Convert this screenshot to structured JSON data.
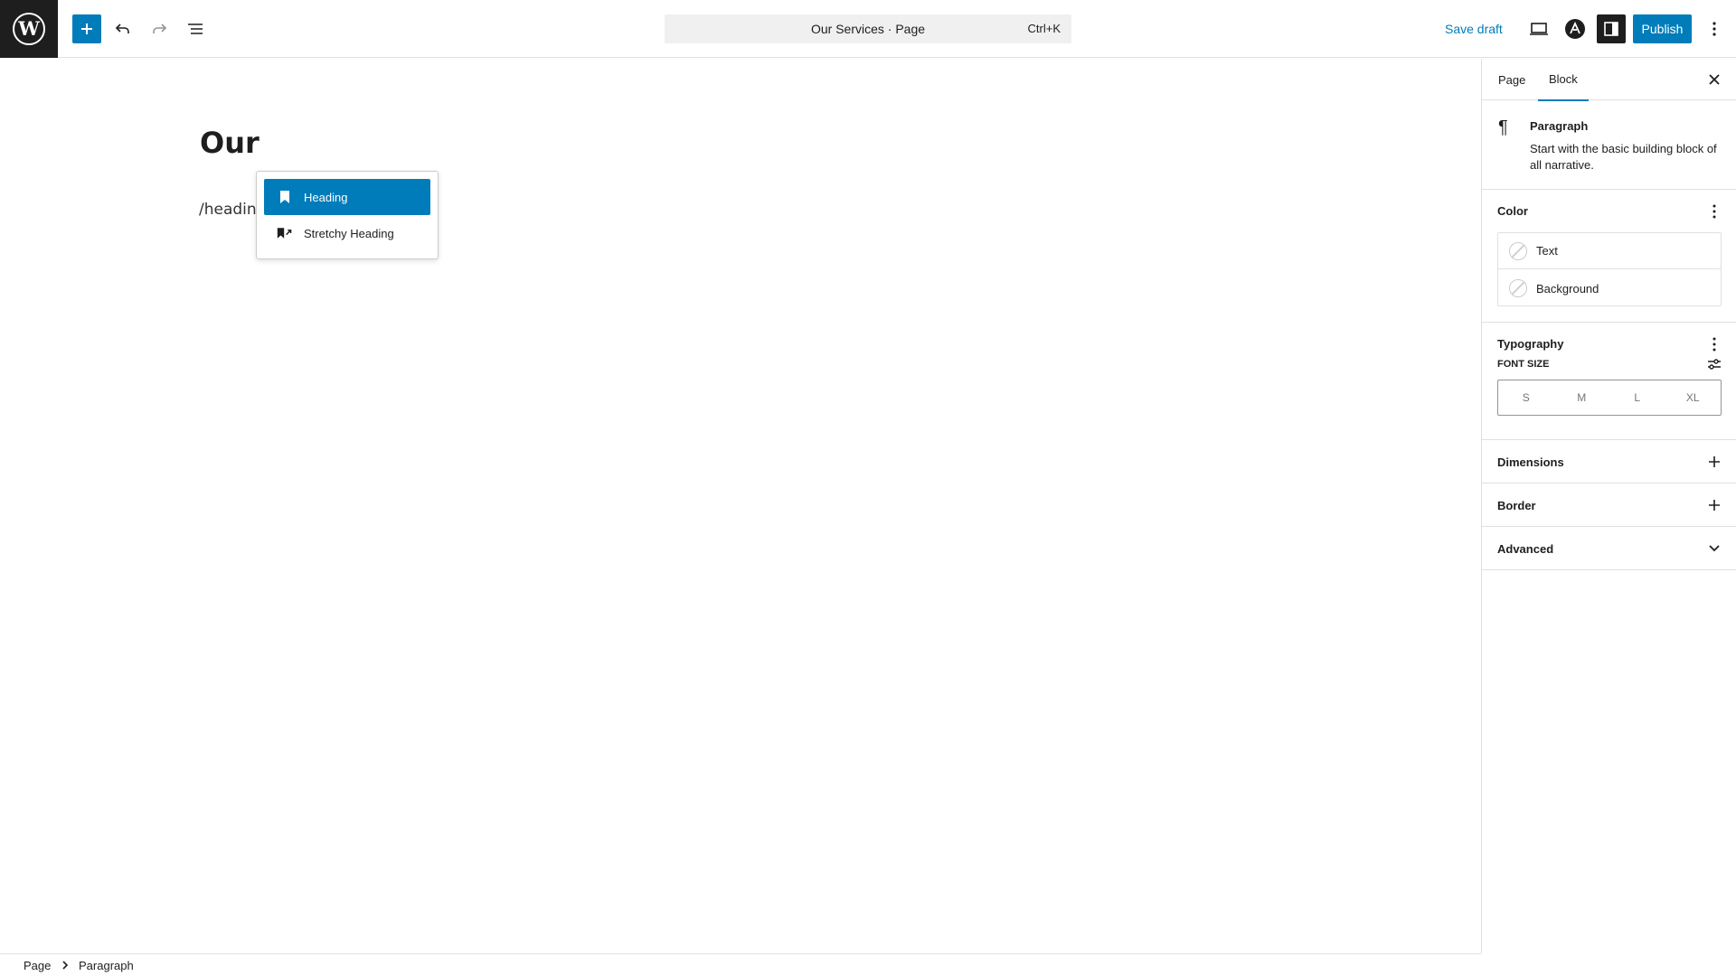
{
  "header": {
    "add_label": "+",
    "command_title": "Our Services · Page",
    "command_shortcut": "Ctrl+K",
    "save_draft": "Save draft",
    "publish": "Publish"
  },
  "canvas": {
    "title": "Our",
    "paragraph": "/heading",
    "popover": {
      "items": [
        {
          "label": "Heading",
          "icon": "bookmark-icon"
        },
        {
          "label": "Stretchy Heading",
          "icon": "stretchy-heading-icon"
        }
      ]
    }
  },
  "sidebar": {
    "tabs": [
      "Page",
      "Block"
    ],
    "active_tab": "Block",
    "block": {
      "icon": "¶",
      "name": "Paragraph",
      "description": "Start with the basic building block of all narrative."
    },
    "color": {
      "title": "Color",
      "items": [
        "Text",
        "Background"
      ]
    },
    "typography": {
      "title": "Typography",
      "font_size_label": "FONT SIZE",
      "sizes": [
        "S",
        "M",
        "L",
        "XL"
      ]
    },
    "dimensions": {
      "title": "Dimensions"
    },
    "border": {
      "title": "Border"
    },
    "advanced": {
      "title": "Advanced"
    }
  },
  "footer": {
    "breadcrumb": [
      "Page",
      "Paragraph"
    ]
  },
  "colors": {
    "accent": "#007cba",
    "dark": "#1e1e1e",
    "border": "#e0e0e0"
  }
}
